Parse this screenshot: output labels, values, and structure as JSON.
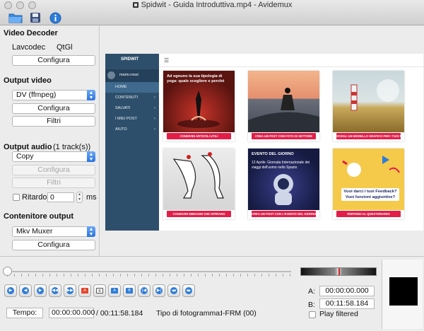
{
  "window": {
    "title": "Spidwit - Guida Introduttiva.mp4 - Avidemux"
  },
  "toolbar": {
    "icons": [
      "open-folder-icon",
      "save-icon",
      "info-icon"
    ]
  },
  "video_decoder": {
    "heading": "Video Decoder",
    "decoder_name": "Lavcodec",
    "decoder_sub": "QtGl",
    "configure_label": "Configura"
  },
  "output_video": {
    "heading": "Output video",
    "codec": "DV (ffmpeg)",
    "configure_label": "Configura",
    "filters_label": "Filtri"
  },
  "output_audio": {
    "heading": "Output audio",
    "tracks": "(1 track(s))",
    "codec": "Copy",
    "configure_label": "Configura",
    "filters_label": "Filtri",
    "delay_label": "Ritardo:",
    "delay_value": "0",
    "delay_unit": "ms"
  },
  "container": {
    "heading": "Contenitore output",
    "muxer": "Mkv Muxer",
    "configure_label": "Configura"
  },
  "preview": {
    "logo": "SPIDWIT",
    "username": "mario.rossi",
    "nav": [
      {
        "label": "HOME",
        "active": true
      },
      {
        "label": "CONTENUTI"
      },
      {
        "label": "SALVATI"
      },
      {
        "label": "I MIEI POST"
      },
      {
        "label": "AIUTO"
      }
    ],
    "cards": [
      {
        "caption": "Ad ognuno la sua tipologia di yoga: quale scegliere e perché",
        "button": "CONDIVIDI ARTICOLI UTILI"
      },
      {
        "caption": "",
        "button": "CREA UN POST CON FOTO DI SETTORE"
      },
      {
        "caption": "",
        "button": "SCEGLI UN MODELLO GRAFICO PER I TUOI POST"
      },
      {
        "caption": "",
        "button": "CONDIVIDI IMMAGINI CHE ISPIRANO"
      },
      {
        "caption": "EVENTO DEL GIORNO",
        "subcaption": "12 Aprile: Giornata Internazionale dei viaggi dell'uomo nello Spazio",
        "button": "CREA UN POST CON L'EVENTO DEL GIORNO"
      },
      {
        "caption": "Vuoi darci i tuoi Feedback? Vuoi funzioni aggiuntive?",
        "button": "RISPONDI AL QUESTIONARIO"
      }
    ]
  },
  "playback": {
    "position": 0.0,
    "tempo_label": "Tempo:",
    "current_time": "00:00:00.000",
    "total_time": "/ 00:11:58.184",
    "frame_type_label": "Tipo di fotogramma:",
    "frame_type": "I-FRM (00)",
    "a_label": "A:",
    "a_time": "00:00:00.000",
    "b_label": "B:",
    "b_time": "00:11:58.184",
    "play_filtered_label": "Play filtered",
    "controls": [
      "play-icon",
      "rewind-icon",
      "forward-icon",
      "previous-keyframe-icon",
      "next-keyframe-icon",
      "set-marker-a-icon",
      "set-marker-b-icon",
      "goto-marker-a-icon",
      "goto-marker-b-icon",
      "first-frame-icon",
      "last-frame-icon",
      "previous-black-frame-icon",
      "next-black-frame-icon"
    ]
  }
}
